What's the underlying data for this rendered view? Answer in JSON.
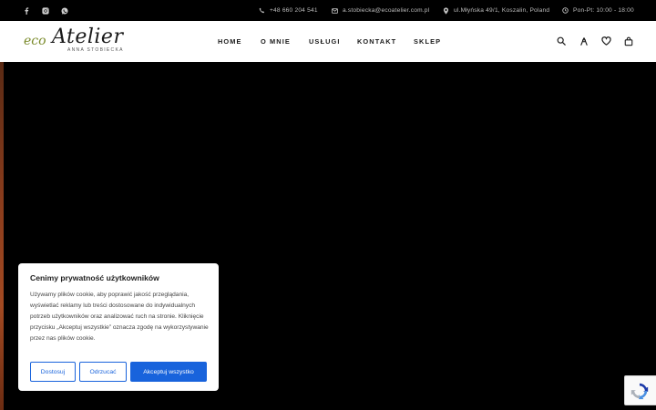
{
  "topbar": {
    "social": [
      "facebook-icon",
      "instagram-icon",
      "whatsapp-icon"
    ],
    "phone": "+48 660 204 541",
    "email": "a.stobiecka@ecoatelier.com.pl",
    "address": "ul.Młyńska 49/1, Koszalin, Poland",
    "hours": "Pon-Pt: 10:00 - 18:00"
  },
  "header": {
    "logo": {
      "eco": "eco",
      "atelier": "Atelier",
      "sub": "ANNA STOBIECKA"
    },
    "nav": [
      "HOME",
      "O MNIE",
      "USŁUGI",
      "KONTAKT",
      "SKLEP"
    ],
    "icons": [
      "search-icon",
      "user-icon",
      "heart-icon",
      "bag-icon"
    ]
  },
  "cookie": {
    "title": "Cenimy prywatność użytkowników",
    "text": "Używamy plików cookie, aby poprawić jakość przeglądania, wyświetlać reklamy lub treści dostosowane do indywidualnych potrzeb użytkowników oraz analizować ruch na stronie. Kliknięcie przycisku „Akceptuj wszystkie” oznacza zgodę na wykorzystywanie przez nas plików cookie.",
    "buttons": {
      "customize": "Dostosuj",
      "reject": "Odrzucać",
      "accept": "Akceptuj wszystko"
    }
  },
  "colors": {
    "accent": "#1863dc",
    "topbar_bg": "#000000",
    "logo_green": "#7a8a2a"
  }
}
